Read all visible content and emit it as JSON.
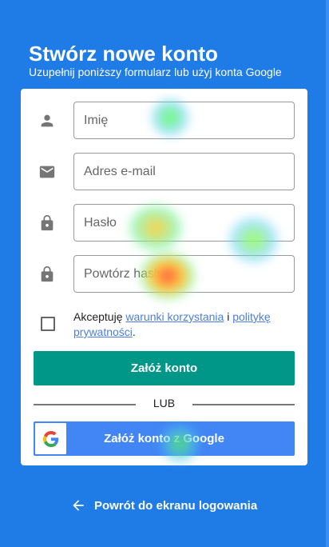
{
  "header": {
    "title": "Stwórz nowe konto",
    "subtitle": "Uzupełnij poniższy formularz lub użyj konta Google"
  },
  "form": {
    "first_name_placeholder": "Imię",
    "email_placeholder": "Adres e-mail",
    "password_placeholder": "Hasło",
    "repeat_password_placeholder": "Powtórz hasło",
    "terms": {
      "prefix": "Akceptuję ",
      "terms_link": "warunki korzystania",
      "middle": " i ",
      "privacy_link": "politykę prywatności",
      "suffix": "."
    },
    "submit_label": "Załóż konto",
    "divider_label": "LUB",
    "google_label": "Załóż konto z Google"
  },
  "footer": {
    "back_label": "Powrót do ekranu logowania"
  },
  "colors": {
    "background": "#1f7be6",
    "primary": "#009688",
    "google": "#4285f4"
  }
}
